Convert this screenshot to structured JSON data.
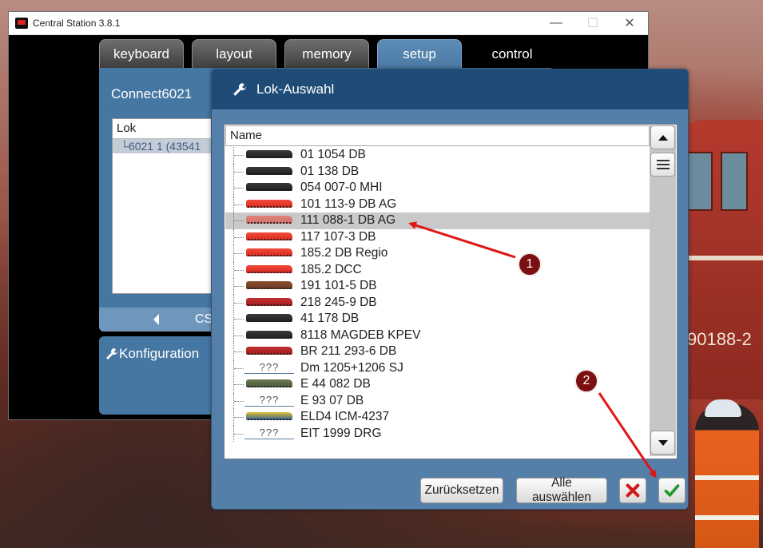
{
  "window": {
    "title": "Central Station 3.8.1"
  },
  "tabs": [
    {
      "label": "keyboard"
    },
    {
      "label": "layout"
    },
    {
      "label": "memory"
    },
    {
      "label": "setup"
    },
    {
      "label": "control"
    }
  ],
  "setup_panel": {
    "title": "Connect6021",
    "lok_header": "Lok",
    "lok_entry": "6021 1 (43541",
    "footer_text": "CS",
    "config_label": "Konfiguration"
  },
  "dialog": {
    "title": "Lok-Auswahl",
    "column_header": "Name",
    "items": [
      {
        "name": "01 1054 DB",
        "icon": "steam-loco-black"
      },
      {
        "name": "01 138 DB",
        "icon": "steam-loco-black"
      },
      {
        "name": "054 007-0 MHI",
        "icon": "steam-loco-black"
      },
      {
        "name": "101 113-9 DB AG",
        "icon": "electric-loco-red"
      },
      {
        "name": "111 088-1 DB AG",
        "icon": "electric-loco-red",
        "selected": true
      },
      {
        "name": "117 107-3 DB",
        "icon": "electric-loco-red"
      },
      {
        "name": "185.2 DB Regio",
        "icon": "electric-loco-red"
      },
      {
        "name": "185.2 DCC",
        "icon": "electric-loco-red"
      },
      {
        "name": "191 101-5 DB",
        "icon": "electric-loco-brown"
      },
      {
        "name": "218 245-9 DB",
        "icon": "diesel-loco-red"
      },
      {
        "name": "41 178 DB",
        "icon": "steam-loco-black"
      },
      {
        "name": "8118 MAGDEB KPEV",
        "icon": "steam-loco-black"
      },
      {
        "name": "BR 211 293-6 DB",
        "icon": "diesel-loco-red"
      },
      {
        "name": "Dm 1205+1206 SJ",
        "icon": "unknown-loco"
      },
      {
        "name": "E 44 082 DB",
        "icon": "electric-loco-green"
      },
      {
        "name": "E 93 07 DB",
        "icon": "unknown-loco"
      },
      {
        "name": "ELD4 ICM-4237",
        "icon": "railcar-blue"
      },
      {
        "name": "EIT 1999 DRG",
        "icon": "unknown-loco"
      }
    ],
    "unknown_label": "???",
    "buttons": {
      "reset": "Zurücksetzen",
      "select_all": "Alle auswählen"
    }
  },
  "annotations": [
    {
      "label": "1"
    },
    {
      "label": "2"
    }
  ],
  "colors": {
    "panel_blue": "#4677a3",
    "dialog_header": "#1f4c77",
    "annotation_red": "#e01515",
    "cancel_red": "#d11a1a",
    "ok_green": "#1f9a2e"
  }
}
